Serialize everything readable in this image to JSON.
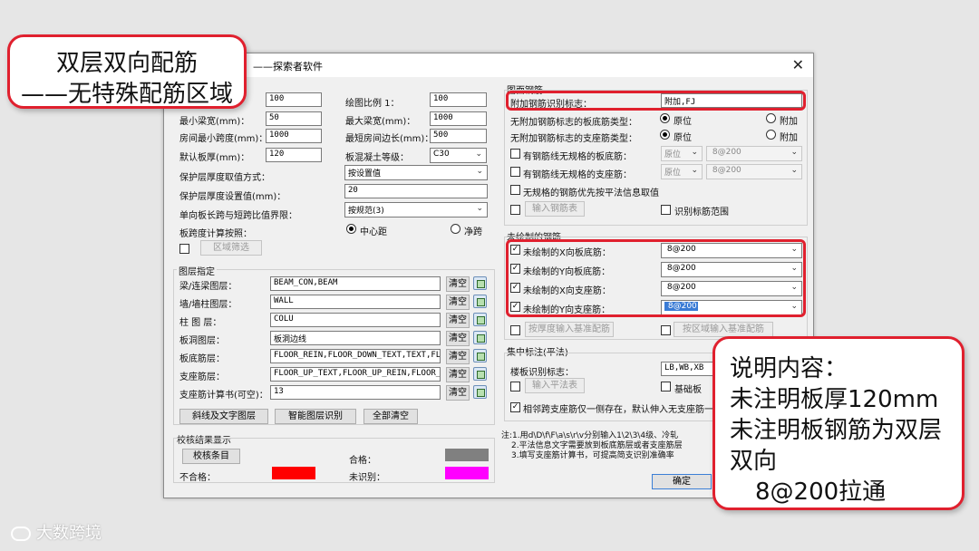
{
  "callout_top": {
    "line1": "双层双向配筋",
    "line2": "——无特殊配筋区域"
  },
  "callout_right": {
    "line1": "说明内容：",
    "line2": "未注明板厚120mm",
    "line3": "未注明板钢筋为双层",
    "line4": "双向",
    "line5": "8@200拉通"
  },
  "watermark": "大数跨境",
  "dialog": {
    "title": "——探索者软件",
    "left": {
      "unlabeled_value": "100",
      "min_beam_label": "最小梁宽(mm)：",
      "min_beam": "50",
      "room_min_span_label": "房间最小跨度(mm)：",
      "room_min_span": "1000",
      "default_thick_label": "默认板厚(mm)：",
      "default_thick": "120",
      "scale_label": "绘图比例 1：",
      "scale": "100",
      "max_beam_label": "最大梁宽(mm)：",
      "max_beam": "1000",
      "room_short_label": "最短房间边长(mm)：",
      "room_short": "500",
      "concrete_label": "板混凝土等级：",
      "concrete": "C30",
      "cover_mode_label": "保护层厚度取值方式：",
      "cover_mode": "按设置值",
      "cover_value_label": "保护层厚度设置值(mm)：",
      "cover_value": "20",
      "ratio_label": "单向板长跨与短跨比值界限：",
      "ratio": "按规范(3)",
      "span_calc_label": "板跨度计算按照：",
      "span_center": "中心距",
      "span_net": "净跨",
      "region_filter_btn": "区域筛选"
    },
    "layers": {
      "group_label": "图层指定",
      "rows": [
        {
          "label": "梁/连梁图层：",
          "value": "BEAM_CON,BEAM"
        },
        {
          "label": "墙/墙柱图层：",
          "value": "WALL"
        },
        {
          "label": "柱 图 层：",
          "value": "COLU"
        },
        {
          "label": "板洞图层：",
          "value": "板洞边线"
        },
        {
          "label": "板底筋层：",
          "value": "FLOOR_REIN,FLOOR_DOWN_TEXT,TEXT,FL"
        },
        {
          "label": "支座筋层：",
          "value": "FLOOR_UP_TEXT,FLOOR_UP_REIN,FLOOR_"
        },
        {
          "label": "支座筋计算书(可空)：",
          "value": "13"
        }
      ],
      "clear_label": "清空",
      "btn_slash": "斜线及文字图层",
      "btn_smart": "智能图层识别",
      "btn_clear_all": "全部清空"
    },
    "check": {
      "group_label": "校核结果显示",
      "btn": "校核条目",
      "pass_label": "合格：",
      "pass_color": "#808080",
      "fail_label": "不合格：",
      "fail_color": "#ff0000",
      "unknown_label": "未识别：",
      "unknown_color": "#ff00ff"
    },
    "drawing": {
      "group_label": "图面钢筋",
      "extra_label": "附加钢筋识别标志：",
      "extra_value": "附加,FJ",
      "no_mark_bottom_label": "无附加钢筋标志的板底筋类型：",
      "no_mark_support_label": "无附加钢筋标志的支座筋类型：",
      "orig": "原位",
      "add": "附加",
      "nonstd_bottom_label": "有钢筋线无规格的板底筋：",
      "nonstd_support_label": "有钢筋线无规格的支座筋：",
      "pos_value": "原位",
      "rebar_value": " 8@200",
      "priority_label": "无规格的钢筋优先按平法信息取值",
      "input_table_btn": "输入钢筋表",
      "identify_range_label": "识别标筋范围"
    },
    "undrawn": {
      "group_label": "未绘制的钢筋",
      "rows": [
        {
          "label": "未绘制的X向板底筋：",
          "value": " 8@200"
        },
        {
          "label": "未绘制的Y向板底筋：",
          "value": " 8@200"
        },
        {
          "label": "未绘制的X向支座筋：",
          "value": " 8@200"
        },
        {
          "label": "未绘制的Y向支座筋：",
          "value": " 8@200"
        }
      ],
      "btn_by_thickness": "按厚度输入基准配筋",
      "btn_by_region": "按区域输入基准配筋"
    },
    "concentrated": {
      "group_label": "集中标注(平法)",
      "mark_label": "楼板识别标志：",
      "mark_value": "LB,WB,XB",
      "input_btn": "输入平法表",
      "base_label": "基础板",
      "adjacent_label": "相邻跨支座筋仅一侧存在，默认伸入无支座筋一"
    },
    "notes": {
      "line1": "注:1.用d\\D\\f\\F\\a\\s\\r\\v分别输入1\\2\\3\\4级、冷轧",
      "line2": "2.平法信息文字需要放到板底筋层或者支座筋层",
      "line3": "3.填写支座筋计算书，可提高简支识别准确率"
    },
    "ok_btn": "确定"
  }
}
